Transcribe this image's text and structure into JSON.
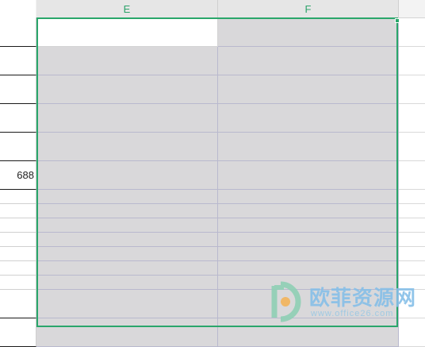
{
  "columns": [
    "E",
    "F"
  ],
  "cell_value": "688",
  "colors": {
    "selection_border": "#2aa66b",
    "selection_fill": "#d9d8da",
    "header_text": "#2da36a"
  },
  "watermark": {
    "logo": "office26-logo-icon",
    "cn_text": "欧菲资源网",
    "en_text": "www.office26.com"
  }
}
